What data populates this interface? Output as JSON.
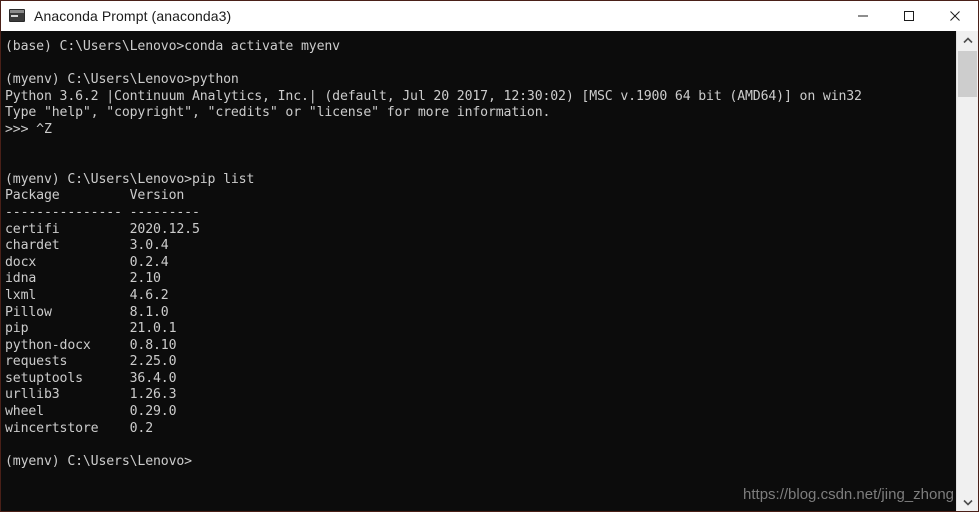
{
  "window": {
    "title": "Anaconda Prompt (anaconda3)",
    "icon": "console-icon",
    "background_color": "#0c0c0c",
    "text_color": "#cccccc",
    "border_color": "#4a2018",
    "titlebar_color": "#ffffff"
  },
  "window_controls": {
    "minimize": "minimize-icon",
    "maximize": "maximize-icon",
    "close": "close-icon"
  },
  "terminal": {
    "lines": [
      "(base) C:\\Users\\Lenovo>conda activate myenv",
      "",
      "(myenv) C:\\Users\\Lenovo>python",
      "Python 3.6.2 |Continuum Analytics, Inc.| (default, Jul 20 2017, 12:30:02) [MSC v.1900 64 bit (AMD64)] on win32",
      "Type \"help\", \"copyright\", \"credits\" or \"license\" for more information.",
      ">>> ^Z",
      "",
      "",
      "(myenv) C:\\Users\\Lenovo>pip list",
      "Package         Version",
      "--------------- ---------",
      "certifi         2020.12.5",
      "chardet         3.0.4",
      "docx            0.2.4",
      "idna            2.10",
      "lxml            4.6.2",
      "Pillow          8.1.0",
      "pip             21.0.1",
      "python-docx     0.8.10",
      "requests        2.25.0",
      "setuptools      36.4.0",
      "urllib3         1.26.3",
      "wheel           0.29.0",
      "wincertstore    0.2",
      "",
      "(myenv) C:\\Users\\Lenovo>"
    ],
    "commands": [
      "conda activate myenv",
      "python",
      "pip list"
    ],
    "environments": {
      "initial": "base",
      "activated": "myenv"
    },
    "current_directory": "C:\\Users\\Lenovo",
    "python_version_banner": {
      "version": "Python 3.6.2",
      "distribution": "|Continuum Analytics, Inc.|",
      "build": "(default, Jul 20 2017, 12:30:02)",
      "compiler": "[MSC v.1900 64 bit (AMD64)]",
      "platform": "on win32",
      "help_hint": "Type \"help\", \"copyright\", \"credits\" or \"license\" for more information.",
      "exit_input": ">>> ^Z"
    },
    "pip_list": {
      "headers": [
        "Package",
        "Version"
      ],
      "separator": [
        "---------------",
        "---------"
      ],
      "rows": [
        [
          "certifi",
          "2020.12.5"
        ],
        [
          "chardet",
          "3.0.4"
        ],
        [
          "docx",
          "0.2.4"
        ],
        [
          "idna",
          "2.10"
        ],
        [
          "lxml",
          "4.6.2"
        ],
        [
          "Pillow",
          "8.1.0"
        ],
        [
          "pip",
          "21.0.1"
        ],
        [
          "python-docx",
          "0.8.10"
        ],
        [
          "requests",
          "2.25.0"
        ],
        [
          "setuptools",
          "36.4.0"
        ],
        [
          "urllib3",
          "1.26.3"
        ],
        [
          "wheel",
          "0.29.0"
        ],
        [
          "wincertstore",
          "0.2"
        ]
      ]
    },
    "prompt": "(myenv) C:\\Users\\Lenovo>"
  },
  "watermark": {
    "text": "https://blog.csdn.net/jing_zhong"
  },
  "scrollbar": {
    "up_arrow": "chevron-up-icon",
    "down_arrow": "chevron-down-icon",
    "thumb": "scrollbar-thumb"
  }
}
